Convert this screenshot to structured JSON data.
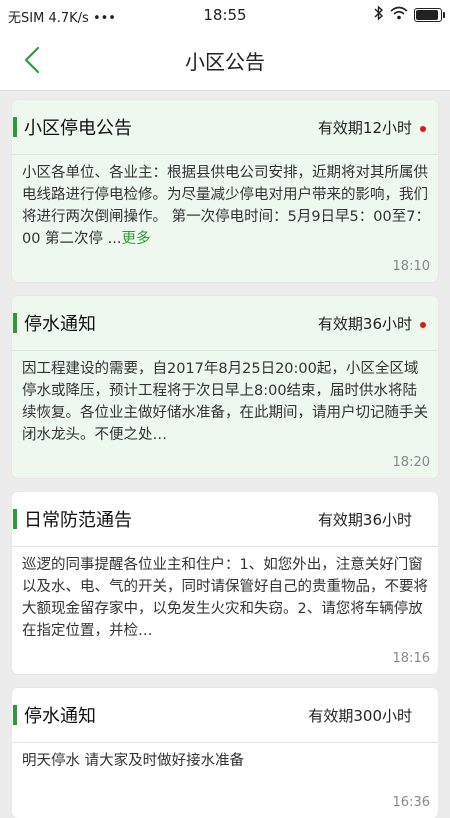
{
  "status_bar": {
    "carrier": "无SIM",
    "speed": "4.7K/s",
    "dots": "•••",
    "time": "18:55",
    "bluetooth_icon": "bluetooth-icon",
    "wifi_icon": "wifi-icon",
    "battery_icon": "battery-icon"
  },
  "nav": {
    "title": "小区公告",
    "back_icon": "chevron-left-icon"
  },
  "colors": {
    "accent": "#2e9b3a",
    "unread_dot": "#e0161e",
    "unread_card_bg": "#eef8ee"
  },
  "notices": [
    {
      "title": "小区停电公告",
      "validity": "有效期12小时",
      "unread": true,
      "body": "小区各单位、各业主：根据县供电公司安排，近期将对其所属供电线路进行停电检修。为尽量减少停电对用户带来的影响，我们将进行两次倒闸操作。 第一次停电时间：5月9日早5：00至7：00 第二次停 ...",
      "more_label": "更多",
      "time": "18:10"
    },
    {
      "title": "停水通知",
      "validity": "有效期36小时",
      "unread": true,
      "body": "因工程建设的需要，自2017年8月25日20:00起，小区全区域停水或降压，预计工程将于次日早上8:00结束，届时供水将陆续恢复。各位业主做好储水准备，在此期间，请用户切记随手关闭水龙头。不便之处…",
      "time": "18:20"
    },
    {
      "title": "日常防范通告",
      "validity": "有效期36小时",
      "unread": false,
      "body": "巡逻的同事提醒各位业主和住户：1、如您外出，注意关好门窗以及水、电、气的开关，同时请保管好自己的贵重物品，不要将大额现金留存家中，以免发生火灾和失窃。2、请您将车辆停放在指定位置，并检…",
      "time": "18:16"
    },
    {
      "title": "停水通知",
      "validity": "有效期300小时",
      "unread": false,
      "body": "明天停水 请大家及时做好接水准备",
      "time": "16:36"
    }
  ]
}
